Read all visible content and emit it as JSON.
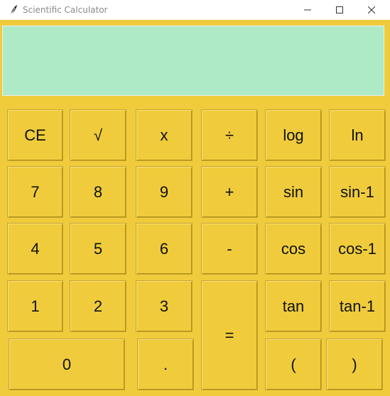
{
  "window": {
    "title": "Scientific Calculator"
  },
  "display": {
    "value": ""
  },
  "buttons": {
    "ce": "CE",
    "sqrt": "√",
    "mul": "x",
    "div": "÷",
    "log": "log",
    "ln": "ln",
    "d7": "7",
    "d8": "8",
    "d9": "9",
    "plus": "+",
    "sin": "sin",
    "asin": "sin-1",
    "d4": "4",
    "d5": "5",
    "d6": "6",
    "minus": "-",
    "cos": "cos",
    "acos": "cos-1",
    "d1": "1",
    "d2": "2",
    "d3": "3",
    "eq": "=",
    "tan": "tan",
    "atan": "tan-1",
    "d0": "0",
    "dot": ".",
    "lparen": "(",
    "rparen": ")"
  },
  "colors": {
    "body": "#f0cc3c",
    "display": "#afeac7"
  },
  "icons": {
    "app": "feather-icon",
    "minimize": "minimize-icon",
    "maximize": "maximize-icon",
    "close": "close-icon"
  }
}
